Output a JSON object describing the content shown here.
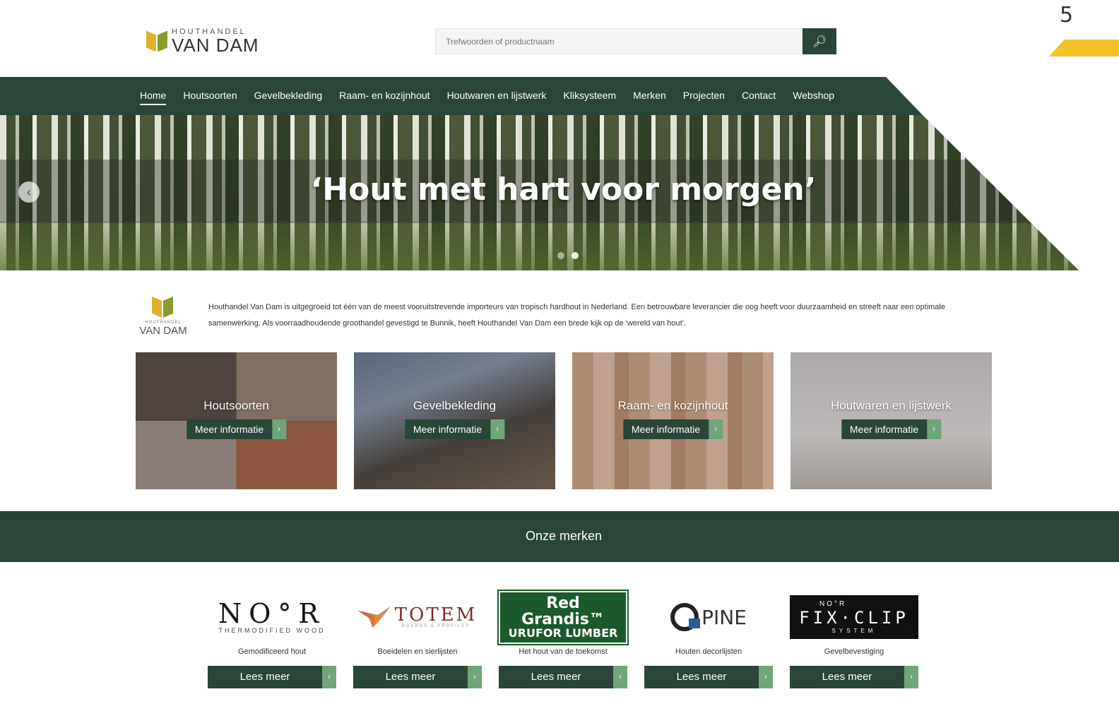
{
  "page_number": "5",
  "logo": {
    "small": "HOUTHANDEL",
    "big": "VAN DAM"
  },
  "search": {
    "placeholder": "Trefwoorden of productnaam",
    "icon": "search-icon"
  },
  "nav": {
    "items": [
      "Home",
      "Houtsoorten",
      "Gevelbekleding",
      "Raam- en kozijnhout",
      "Houtwaren en lijstwerk",
      "Kliksysteem",
      "Merken",
      "Projecten",
      "Contact",
      "Webshop"
    ],
    "active": "Home"
  },
  "hero": {
    "title": "‘Hout met hart voor morgen’",
    "prev_icon": "chevron-left-icon",
    "slides": 2,
    "active_slide": 2
  },
  "intro": {
    "logo_small": "HOUTHANDEL",
    "logo_big": "VAN DAM",
    "text": "Houthandel Van Dam is uitgegroeid tot één van de meest vooruitstrevende importeurs van tropisch hardhout in Nederland. Een betrouwbare leverancier die oog heeft voor duurzaamheid en streeft naar een optimale samenwerking. Als voorraadhoudende groothandel gevestigd te Bunnik, heeft Houthandel Van Dam een brede kijk op de ‘wereld van hout’."
  },
  "tiles": [
    {
      "title": "Houtsoorten",
      "button": "Meer informatie"
    },
    {
      "title": "Gevelbekleding",
      "button": "Meer informatie"
    },
    {
      "title": "Raam- en kozijnhout",
      "button": "Meer informatie"
    },
    {
      "title": "Houtwaren en lijstwerk",
      "button": "Meer informatie"
    }
  ],
  "arrow_glyph": "›",
  "brands_title": "Onze merken",
  "brands": [
    {
      "name": "NO°R",
      "sub": "THERMODIFIED WOOD",
      "caption": "Gemodificeerd hout",
      "button": "Lees meer"
    },
    {
      "name": "TOTEM",
      "sub": "BOARDS & PROFILES",
      "caption": "Boeidelen en sierlijsten",
      "button": "Lees meer"
    },
    {
      "name": "Red Grandis™",
      "sub": "URUFOR LUMBER",
      "caption": "Het hout van de toekomst",
      "button": "Lees meer"
    },
    {
      "name": "PINE",
      "sub": "",
      "caption": "Houten decorlijsten",
      "button": "Lees meer"
    },
    {
      "name": "FIX·CLIP",
      "top": "NO°R",
      "sub": "SYSTEM",
      "caption": "Gevelbevestiging",
      "button": "Lees meer"
    }
  ],
  "colors": {
    "primary": "#2a4638",
    "accent": "#6fa57a",
    "yellow": "#f0c228"
  }
}
